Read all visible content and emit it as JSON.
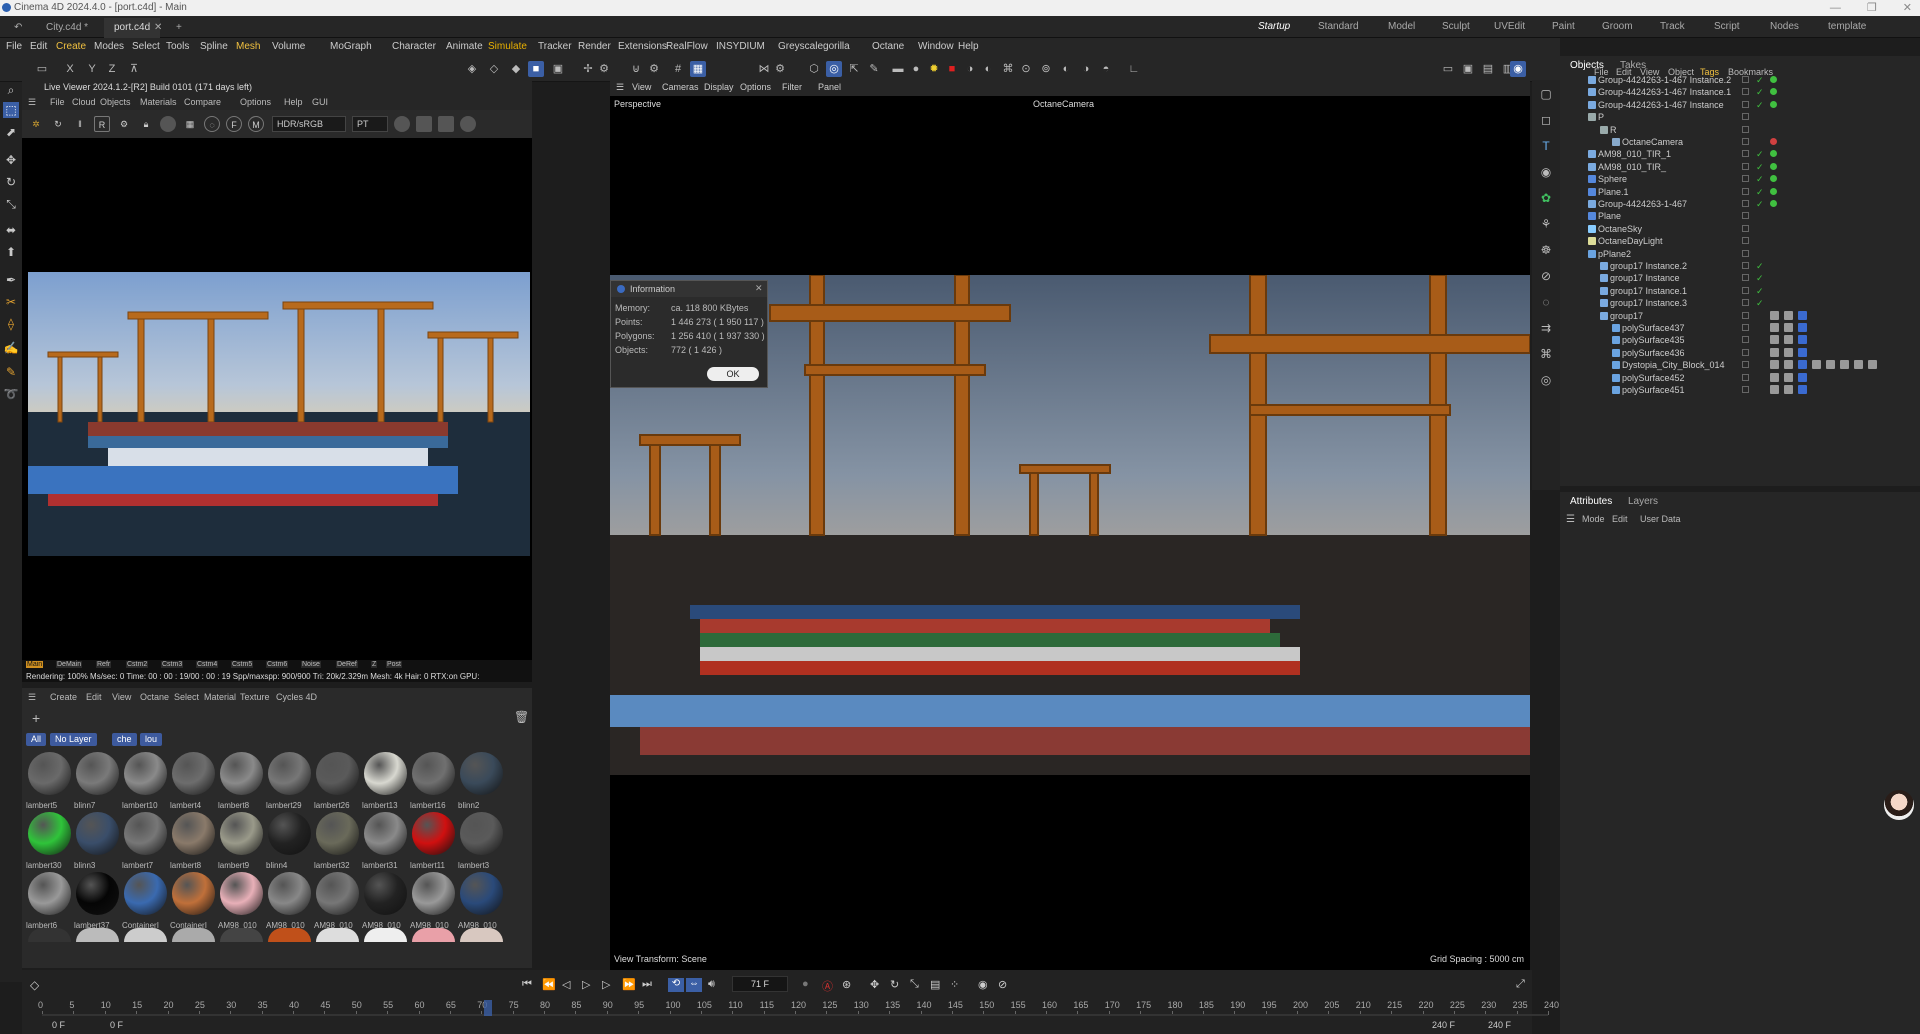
{
  "window": {
    "title": "Cinema 4D 2024.4.0 - [port.c4d] - Main",
    "controls": [
      "—",
      "❐",
      "✕"
    ]
  },
  "doc_tabs": [
    {
      "label": "City.c4d *",
      "active": false
    },
    {
      "label": "port.c4d",
      "active": true
    },
    {
      "label": "+",
      "active": false
    }
  ],
  "layouts": [
    "Startup",
    "Standard",
    "Model",
    "Sculpt",
    "UVEdit",
    "Paint",
    "Groom",
    "Track",
    "Script",
    "Nodes",
    "template"
  ],
  "active_layout": "Startup",
  "menubar": [
    "File",
    "Edit",
    "Create",
    "Modes",
    "Select",
    "Tools",
    "Spline",
    "Mesh",
    "Volume",
    "MoGraph",
    "Character",
    "Animate",
    "Simulate",
    "Tracker",
    "Render",
    "Extensions",
    "RealFlow",
    "INSYDIUM",
    "Greyscalegorilla",
    "Octane",
    "Window",
    "Help"
  ],
  "live_viewer": {
    "title": "Live Viewer 2024.1.2-[R2] Build 0101 (171 days left)",
    "menu": [
      "File",
      "Cloud",
      "Objects",
      "Materials",
      "Compare",
      "Options",
      "Help",
      "GUI"
    ],
    "color_select": "HDR/sRGB",
    "mode_select": "PT",
    "status_tags": [
      "Main",
      "DeMain",
      "Refr",
      "Cstm2",
      "Cstm3",
      "Cstm4",
      "Cstm5",
      "Cstm6",
      "Noise",
      "DeRef",
      "Z",
      "Post"
    ],
    "status_line": "Rendering: 100%   Ms/sec: 0   Time: 00 : 00 : 19/00 : 00 : 19   Spp/maxspp: 900/900      Tri: 20k/2.329m   Mesh: 4k   Hair: 0   RTX:on      GPU:"
  },
  "material_manager": {
    "menu": [
      "Create",
      "Edit",
      "View",
      "Octane",
      "Select",
      "Material",
      "Texture",
      "Cycles 4D"
    ],
    "filters": [
      "All",
      "No Layer",
      "che",
      "lou"
    ],
    "materials": [
      {
        "name": "lambert5",
        "color": "#6a6a6a"
      },
      {
        "name": "blinn7",
        "color": "#7a7a7a"
      },
      {
        "name": "lambert10",
        "color": "#8a8a8a"
      },
      {
        "name": "lambert4",
        "color": "#6d6d6d"
      },
      {
        "name": "lambert8",
        "color": "#8a8a8a"
      },
      {
        "name": "lambert29",
        "color": "#777"
      },
      {
        "name": "lambert26",
        "color": "#5a5a5a"
      },
      {
        "name": "lambert13",
        "color": "#d8d8d0"
      },
      {
        "name": "lambert16",
        "color": "#707070"
      },
      {
        "name": "blinn2",
        "color": "#3a4a5a"
      },
      {
        "name": "lambert30",
        "color": "#2fc43a"
      },
      {
        "name": "blinn3",
        "color": "#3a4e6a"
      },
      {
        "name": "lambert7",
        "color": "#777"
      },
      {
        "name": "lambert8",
        "color": "#8a7a6a"
      },
      {
        "name": "lambert9",
        "color": "#9a9a8a"
      },
      {
        "name": "blinn4",
        "color": "#222"
      },
      {
        "name": "lambert32",
        "color": "#6a6a5a"
      },
      {
        "name": "lambert31",
        "color": "#8a8a8a"
      },
      {
        "name": "lambert11",
        "color": "#d01010"
      },
      {
        "name": "lambert3",
        "color": "#5a5a5a"
      },
      {
        "name": "lambert6",
        "color": "#999"
      },
      {
        "name": "lambert37",
        "color": "#050505"
      },
      {
        "name": "ContainerI",
        "color": "#3a6ab0"
      },
      {
        "name": "ContainerI",
        "color": "#c0703a"
      },
      {
        "name": "AM98_010",
        "color": "#e8b0b8"
      },
      {
        "name": "AM98_010",
        "color": "#888"
      },
      {
        "name": "AM98_010",
        "color": "#777"
      },
      {
        "name": "AM98_010",
        "color": "#222"
      },
      {
        "name": "AM98_010",
        "color": "#999"
      },
      {
        "name": "AM98_010",
        "color": "#2a4a7a"
      }
    ]
  },
  "viewport": {
    "menu": [
      "View",
      "Cameras",
      "Display",
      "Options",
      "Filter",
      "Panel"
    ],
    "projection": "Perspective",
    "camera": "OctaneCamera",
    "view_transform": "View Transform: Scene",
    "grid_spacing": "Grid Spacing : 5000 cm"
  },
  "info_dialog": {
    "title": "Information",
    "rows": [
      {
        "label": "Memory:",
        "value": "ca. 118 800 KBytes"
      },
      {
        "label": "Points:",
        "value": "1 446 273 ( 1 950 117 )"
      },
      {
        "label": "Polygons:",
        "value": "1 256 410 ( 1 937 330 )"
      },
      {
        "label": "Objects:",
        "value": "772 ( 1 426 )"
      }
    ],
    "ok": "OK"
  },
  "timeline": {
    "current_frame": "71 F",
    "start": "0 F",
    "start2": "0 F",
    "end": "240 F",
    "end2": "240 F",
    "ticks": [
      "0",
      "5",
      "10",
      "15",
      "20",
      "25",
      "30",
      "35",
      "40",
      "45",
      "50",
      "55",
      "60",
      "65",
      "70",
      "75",
      "80",
      "85",
      "90",
      "95",
      "100",
      "105",
      "110",
      "115",
      "120",
      "125",
      "130",
      "135",
      "140",
      "145",
      "150",
      "155",
      "160",
      "165",
      "170",
      "175",
      "180",
      "185",
      "190",
      "195",
      "200",
      "205",
      "210",
      "215",
      "220",
      "225",
      "230",
      "235",
      "240"
    ],
    "playhead": "71"
  },
  "object_manager": {
    "tabs": [
      "Objects",
      "Takes"
    ],
    "menu": [
      "File",
      "Edit",
      "View",
      "Object",
      "Tags",
      "Bookmarks"
    ],
    "rows": [
      {
        "name": "Group-4424263-1-467 Instance.2",
        "indent": 0,
        "type": "group"
      },
      {
        "name": "Group-4424263-1-467 Instance.1",
        "indent": 0,
        "type": "group"
      },
      {
        "name": "Group-4424263-1-467 Instance",
        "indent": 0,
        "type": "group"
      },
      {
        "name": "P",
        "indent": 0,
        "type": "null"
      },
      {
        "name": "R",
        "indent": 1,
        "type": "null"
      },
      {
        "name": "OctaneCamera",
        "indent": 2,
        "type": "camera"
      },
      {
        "name": "AM98_010_TIR_1",
        "indent": 0,
        "type": "group"
      },
      {
        "name": "AM98_010_TIR_",
        "indent": 0,
        "type": "group"
      },
      {
        "name": "Sphere",
        "indent": 0,
        "type": "sphere"
      },
      {
        "name": "Plane.1",
        "indent": 0,
        "type": "plane"
      },
      {
        "name": "Group-4424263-1-467",
        "indent": 0,
        "type": "group"
      },
      {
        "name": "Plane",
        "indent": 0,
        "type": "plane"
      },
      {
        "name": "OctaneSky",
        "indent": 0,
        "type": "sky"
      },
      {
        "name": "OctaneDayLight",
        "indent": 0,
        "type": "light"
      },
      {
        "name": "pPlane2",
        "indent": 0,
        "type": "poly"
      },
      {
        "name": "group17 Instance.2",
        "indent": 1,
        "type": "group"
      },
      {
        "name": "group17 Instance",
        "indent": 1,
        "type": "group"
      },
      {
        "name": "group17 Instance.1",
        "indent": 1,
        "type": "group"
      },
      {
        "name": "group17 Instance.3",
        "indent": 1,
        "type": "group"
      },
      {
        "name": "group17",
        "indent": 1,
        "type": "group"
      },
      {
        "name": "polySurface437",
        "indent": 2,
        "type": "poly"
      },
      {
        "name": "polySurface435",
        "indent": 2,
        "type": "poly"
      },
      {
        "name": "polySurface436",
        "indent": 2,
        "type": "poly"
      },
      {
        "name": "Dystopia_City_Block_014",
        "indent": 2,
        "type": "poly"
      },
      {
        "name": "polySurface452",
        "indent": 2,
        "type": "poly"
      },
      {
        "name": "polySurface451",
        "indent": 2,
        "type": "poly"
      }
    ]
  },
  "attributes": {
    "tabs": [
      "Attributes",
      "Layers"
    ],
    "menu": [
      "Mode",
      "Edit",
      "User Data"
    ]
  }
}
